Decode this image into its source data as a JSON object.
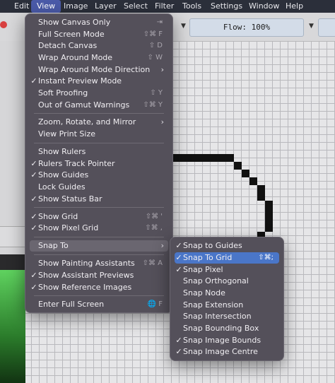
{
  "menubar": {
    "items": [
      "Edit",
      "View",
      "Image",
      "Layer",
      "Select",
      "Filter",
      "Tools",
      "Settings",
      "Window",
      "Help"
    ],
    "active": "View"
  },
  "toolbar": {
    "flow": "Flow: 100%"
  },
  "view_menu": {
    "items": [
      {
        "label": "Show Canvas Only",
        "shortcut": "⇥",
        "checked": false
      },
      {
        "label": "Full Screen Mode",
        "shortcut": "⇧⌘ F",
        "checked": false
      },
      {
        "label": "Detach Canvas",
        "shortcut": "⇧ D",
        "checked": false
      },
      {
        "label": "Wrap Around Mode",
        "shortcut": "⇧ W",
        "checked": false
      },
      {
        "label": "Wrap Around Mode Direction",
        "shortcut": "",
        "submenu": true,
        "checked": false
      },
      {
        "label": "Instant Preview Mode",
        "shortcut": "",
        "checked": true
      },
      {
        "label": "Soft Proofing",
        "shortcut": "⇧ Y",
        "checked": false
      },
      {
        "label": "Out of Gamut Warnings",
        "shortcut": "⇧⌘ Y",
        "checked": false
      },
      {
        "label": "Zoom, Rotate, and Mirror",
        "shortcut": "",
        "submenu": true,
        "checked": false
      },
      {
        "label": "View Print Size",
        "shortcut": "",
        "checked": false
      },
      {
        "label": "Show Rulers",
        "shortcut": "",
        "checked": false
      },
      {
        "label": "Rulers Track Pointer",
        "shortcut": "",
        "checked": true
      },
      {
        "label": "Show Guides",
        "shortcut": "",
        "checked": true
      },
      {
        "label": "Lock Guides",
        "shortcut": "",
        "checked": false
      },
      {
        "label": "Show Status Bar",
        "shortcut": "",
        "checked": true
      },
      {
        "label": "Show Grid",
        "shortcut": "⇧⌘ '",
        "checked": true
      },
      {
        "label": "Show Pixel Grid",
        "shortcut": "⇧⌘ ,",
        "checked": true
      },
      {
        "label": "Snap To",
        "shortcut": "",
        "submenu": true,
        "checked": false
      },
      {
        "label": "Show Painting Assistants",
        "shortcut": "⇧⌘ A",
        "checked": false
      },
      {
        "label": "Show Assistant Previews",
        "shortcut": "",
        "checked": true
      },
      {
        "label": "Show Reference Images",
        "shortcut": "",
        "checked": true
      },
      {
        "label": "Enter Full Screen",
        "shortcut": "🌐 F",
        "checked": false
      }
    ]
  },
  "snap_menu": {
    "items": [
      {
        "label": "Snap to Guides",
        "shortcut": "",
        "checked": true
      },
      {
        "label": "Snap To Grid",
        "shortcut": "⇧⌘;",
        "checked": true
      },
      {
        "label": "Snap Pixel",
        "shortcut": "",
        "checked": true
      },
      {
        "label": "Snap Orthogonal",
        "shortcut": "",
        "checked": false
      },
      {
        "label": "Snap Node",
        "shortcut": "",
        "checked": false
      },
      {
        "label": "Snap Extension",
        "shortcut": "",
        "checked": false
      },
      {
        "label": "Snap Intersection",
        "shortcut": "",
        "checked": false
      },
      {
        "label": "Snap Bounding Box",
        "shortcut": "",
        "checked": false
      },
      {
        "label": "Snap Image Bounds",
        "shortcut": "",
        "checked": true
      },
      {
        "label": "Snap Image Centre",
        "shortcut": "",
        "checked": true
      }
    ]
  },
  "colors": {
    "menu_bg": "#54505a",
    "highlight": "#4a76c8",
    "menubar_active": "#4a5aa8"
  }
}
